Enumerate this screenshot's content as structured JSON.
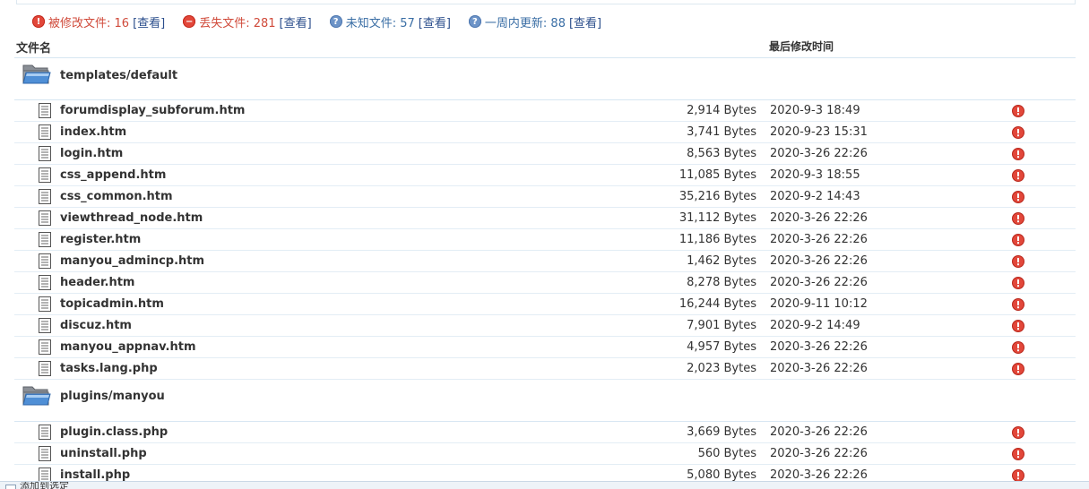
{
  "summary": {
    "modified": {
      "label": "被修改文件: 16",
      "link": "[查看]",
      "icon": "exclamation-icon",
      "color": "#d04a3a"
    },
    "missing": {
      "label": "丢失文件: 281",
      "link": "[查看]",
      "icon": "minus-icon",
      "color": "#d04a3a"
    },
    "unknown": {
      "label": "未知文件: 57",
      "link": "[查看]",
      "icon": "question-icon",
      "color": "#3a6ea5"
    },
    "recent": {
      "label": "一周内更新: 88",
      "link": "[查看]",
      "icon": "question-icon",
      "color": "#3a6ea5"
    }
  },
  "table": {
    "header_name": "文件名",
    "header_time": "最后修改时间"
  },
  "dirs": [
    {
      "name": "templates/default",
      "files": [
        {
          "name": "forumdisplay_subforum.htm",
          "size": "2,914 Bytes",
          "date": "2020-9-3 18:49"
        },
        {
          "name": "index.htm",
          "size": "3,741 Bytes",
          "date": "2020-9-23 15:31"
        },
        {
          "name": "login.htm",
          "size": "8,563 Bytes",
          "date": "2020-3-26 22:26"
        },
        {
          "name": "css_append.htm",
          "size": "11,085 Bytes",
          "date": "2020-9-3 18:55"
        },
        {
          "name": "css_common.htm",
          "size": "35,216 Bytes",
          "date": "2020-9-2 14:43"
        },
        {
          "name": "viewthread_node.htm",
          "size": "31,112 Bytes",
          "date": "2020-3-26 22:26"
        },
        {
          "name": "register.htm",
          "size": "11,186 Bytes",
          "date": "2020-3-26 22:26"
        },
        {
          "name": "manyou_admincp.htm",
          "size": "1,462 Bytes",
          "date": "2020-3-26 22:26"
        },
        {
          "name": "header.htm",
          "size": "8,278 Bytes",
          "date": "2020-3-26 22:26"
        },
        {
          "name": "topicadmin.htm",
          "size": "16,244 Bytes",
          "date": "2020-9-11 10:12"
        },
        {
          "name": "discuz.htm",
          "size": "7,901 Bytes",
          "date": "2020-9-2 14:49"
        },
        {
          "name": "manyou_appnav.htm",
          "size": "4,957 Bytes",
          "date": "2020-3-26 22:26"
        },
        {
          "name": "tasks.lang.php",
          "size": "2,023 Bytes",
          "date": "2020-3-26 22:26"
        }
      ]
    },
    {
      "name": "plugins/manyou",
      "files": [
        {
          "name": "plugin.class.php",
          "size": "3,669 Bytes",
          "date": "2020-3-26 22:26"
        },
        {
          "name": "uninstall.php",
          "size": "560 Bytes",
          "date": "2020-3-26 22:26"
        },
        {
          "name": "install.php",
          "size": "5,080 Bytes",
          "date": "2020-3-26 22:26"
        }
      ]
    }
  ],
  "footer": {
    "label": "添加到选定"
  }
}
